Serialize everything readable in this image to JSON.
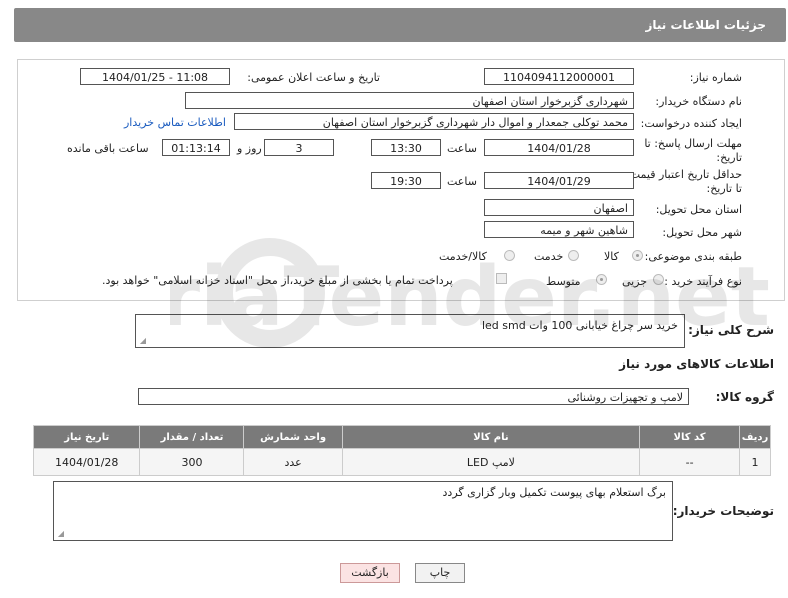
{
  "header": {
    "title": "جزئیات اطلاعات نیاز"
  },
  "fields": {
    "need_number_label": "شماره نیاز:",
    "need_number": "1104094112000001",
    "announce_label": "تاریخ و ساعت اعلان عمومی:",
    "announce_value": "1404/01/25 - 11:08",
    "buyer_org_label": "نام دستگاه خریدار:",
    "buyer_org": "شهرداری گزبرخوار استان اصفهان",
    "creator_label": "ایجاد کننده درخواست:",
    "creator": "محمد توکلی جمعدار و اموال دار شهرداری گزبرخوار استان اصفهان",
    "contact_link": "اطلاعات تماس خریدار",
    "deadline_label_1": "مهلت ارسال پاسخ: تا",
    "deadline_label_2": "تاریخ:",
    "deadline_date": "1404/01/28",
    "time_label": "ساعت",
    "deadline_time": "13:30",
    "days_value": "3",
    "days_label": "روز و",
    "remaining_value": "01:13:14",
    "remaining_label": "ساعت باقی مانده",
    "validity_label_1": "حداقل تاریخ اعتبار قیمت:",
    "validity_label_2": "تا تاریخ:",
    "validity_date": "1404/01/29",
    "validity_time": "19:30",
    "province_label": "استان محل تحویل:",
    "province": "اصفهان",
    "city_label": "شهر محل تحویل:",
    "city": "شاهین شهر و میمه",
    "category_label": "طبقه بندی موضوعی:",
    "category_options": [
      "کالا",
      "خدمت",
      "کالا/خدمت"
    ],
    "process_label": "نوع فرآیند خرید :",
    "process_options": [
      "جزیی",
      "متوسط"
    ],
    "payment_note": "پرداخت تمام یا بخشی از مبلغ خرید،از محل \"اسناد خزانه اسلامی\" خواهد بود."
  },
  "description": {
    "label": "شرح کلی نیاز:",
    "value": "خرید سر چراغ خیابانی 100 وات led smd"
  },
  "goods_section": {
    "title": "اطلاعات کالاهای مورد نیاز",
    "group_label": "گروه کالا:",
    "group_value": "لامپ و تجهیزات روشنائی"
  },
  "table": {
    "headers": [
      "ردیف",
      "کد کالا",
      "نام کالا",
      "واحد شمارش",
      "تعداد / مقدار",
      "تاریخ نیاز"
    ],
    "rows": [
      [
        "1",
        "--",
        "لامپ LED",
        "عدد",
        "300",
        "1404/01/28"
      ]
    ]
  },
  "buyer_notes": {
    "label": "توضیحات خریدار:",
    "value": "برگ استعلام بهای پیوست تکمیل وبار گزاری گردد"
  },
  "buttons": {
    "print": "چاپ",
    "back": "بازگشت"
  },
  "watermark": {
    "text": "AriaTender.net"
  }
}
